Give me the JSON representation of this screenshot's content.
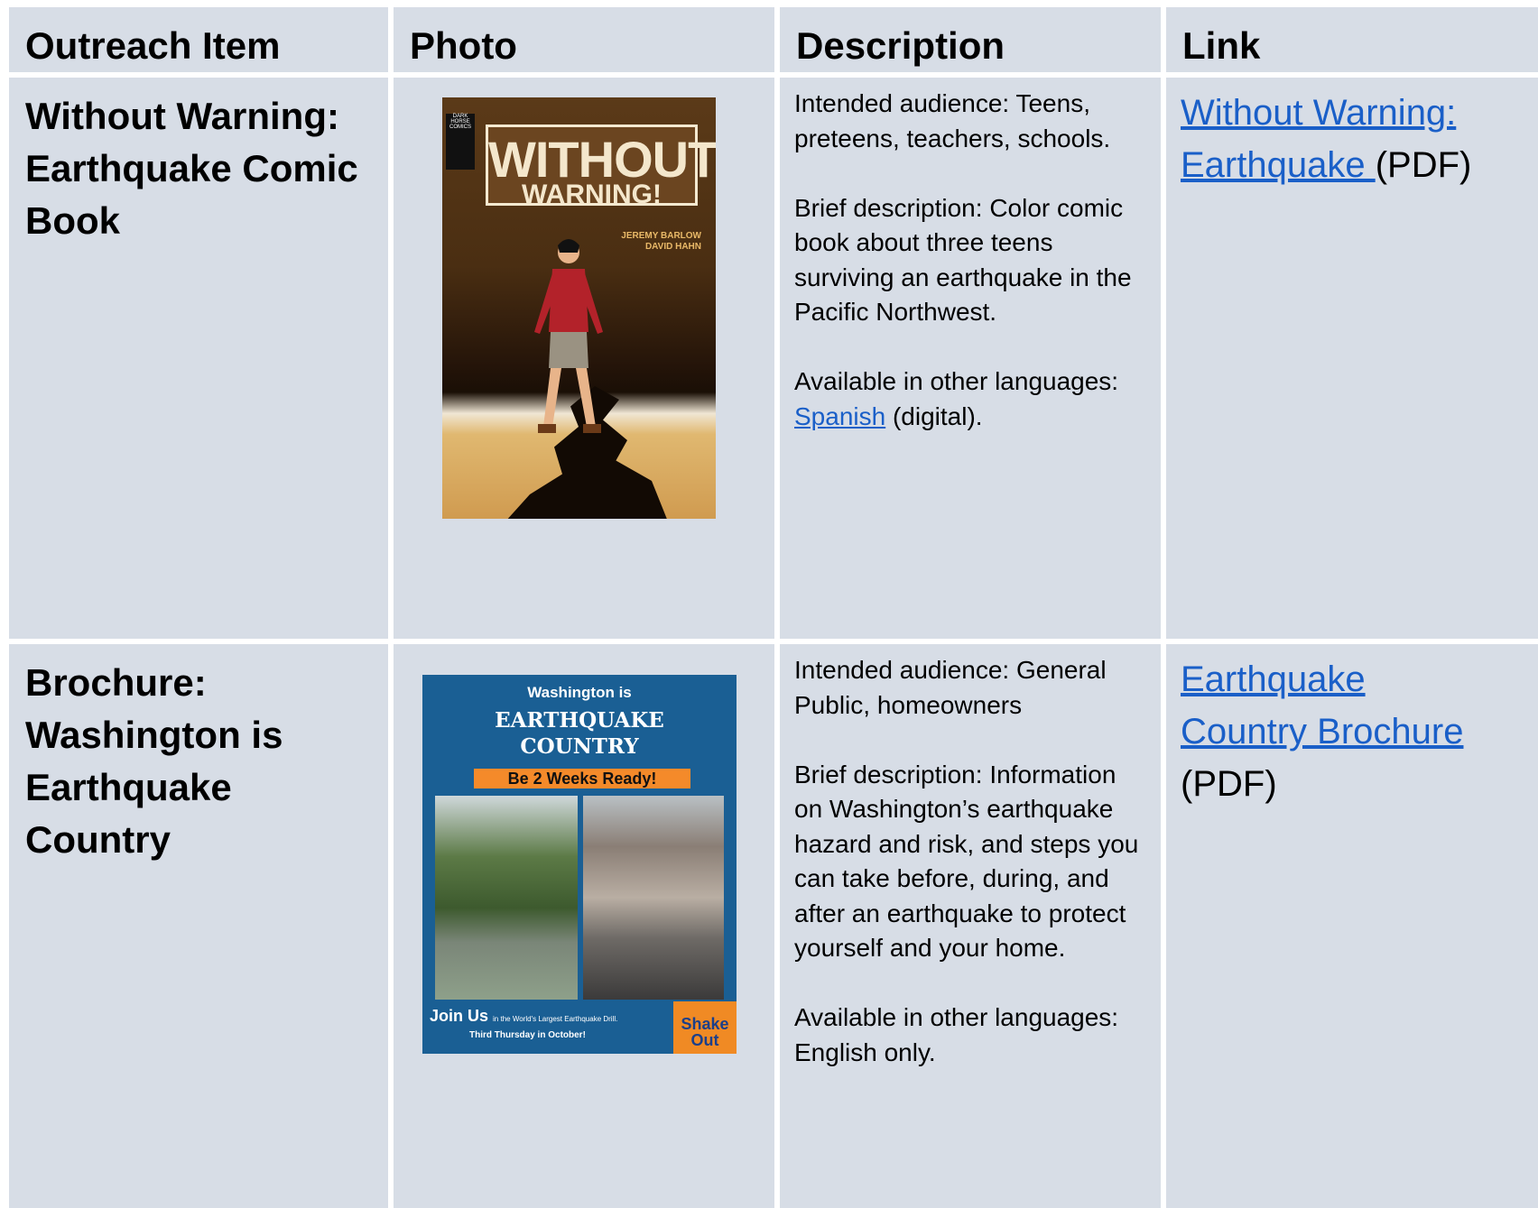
{
  "headers": {
    "outreach_item": "Outreach Item",
    "photo": "Photo",
    "description": "Description",
    "link": "Link"
  },
  "rows": [
    {
      "title_lines": [
        "Without Warning:",
        "Earthquake Comic",
        "Book"
      ],
      "photo": {
        "publisher_logo": "DARK HORSE COMICS",
        "title_line1": "WITHOUT",
        "title_line2": "WARNING!",
        "authors_line1": "JEREMY BARLOW",
        "authors_line2": "DAVID HAHN"
      },
      "audience": "Intended audience: Teens, preteens, teachers, schools.",
      "brief": "Brief description: Color comic book about three teens surviving an earthquake in the Pacific Northwest.",
      "languages_prefix": "Available in other languages:",
      "languages_link": "Spanish",
      "languages_suffix": " (digital).",
      "link_text_1": "Without Warning:",
      "link_text_2": "Earthquake ",
      "link_suffix": "(PDF)"
    },
    {
      "title_lines": [
        "Brochure:",
        "Washington is",
        "Earthquake",
        "Country"
      ],
      "photo": {
        "line1": "Washington is",
        "line2": "EARTHQUAKE",
        "line3": "COUNTRY",
        "banner": "Be 2 Weeks Ready!",
        "join": "Join Us",
        "join_small": "in the World's Largest Earthquake Drill.",
        "third": "Third Thursday in October!",
        "shakeout_line1": "Shake",
        "shakeout_line2": "Out"
      },
      "audience": "Intended audience: General Public, homeowners",
      "brief": "Brief description: Information on Washington’s earthquake hazard and risk, and steps you can take before, during, and after an earthquake to protect yourself and your home.",
      "languages": "Available in other languages: English only.",
      "link_text_1": "Earthquake",
      "link_text_2": "Country Brochure",
      "link_suffix": "(PDF)"
    }
  ],
  "colors": {
    "cell_bg": "#d7dde6",
    "link": "#1a5fc8"
  }
}
